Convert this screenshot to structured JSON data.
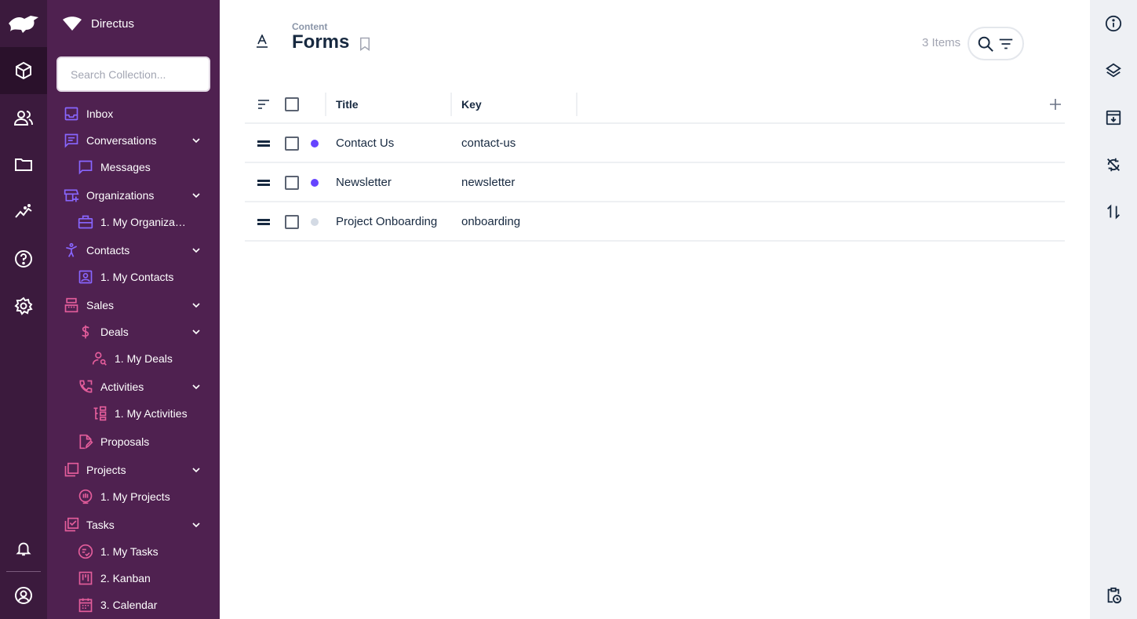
{
  "app": {
    "project_name": "Directus"
  },
  "module_bar": {
    "items": [
      "content-icon",
      "users-icon",
      "files-icon",
      "insights-icon",
      "help-icon",
      "settings-icon"
    ],
    "bottom": [
      "notifications-icon",
      "account-icon"
    ]
  },
  "nav": {
    "search_placeholder": "Search Collection...",
    "items": [
      {
        "label": "Inbox",
        "icon": "inbox-icon"
      },
      {
        "label": "Conversations",
        "icon": "chat-icon"
      },
      {
        "label": "Messages",
        "icon": "message-icon"
      },
      {
        "label": "Organizations",
        "icon": "domain-add-icon"
      },
      {
        "label": "1. My Organiza…",
        "icon": "briefcase-icon"
      },
      {
        "label": "Contacts",
        "icon": "person-icon"
      },
      {
        "label": "1. My Contacts",
        "icon": "contact-card-icon"
      },
      {
        "label": "Sales",
        "icon": "register-icon"
      },
      {
        "label": "Deals",
        "icon": "dollar-icon"
      },
      {
        "label": "1. My Deals",
        "icon": "person-search-icon"
      },
      {
        "label": "Activities",
        "icon": "phone-forward-icon"
      },
      {
        "label": "1. My Activities",
        "icon": "tree-icon"
      },
      {
        "label": "Proposals",
        "icon": "edit-document-icon"
      },
      {
        "label": "Projects",
        "icon": "library-icon"
      },
      {
        "label": "1. My Projects",
        "icon": "hand-icon"
      },
      {
        "label": "Tasks",
        "icon": "checkbox-icon"
      },
      {
        "label": "1. My Tasks",
        "icon": "task-list-icon"
      },
      {
        "label": "2. Kanban",
        "icon": "kanban-icon"
      },
      {
        "label": "3. Calendar",
        "icon": "calendar-icon"
      }
    ]
  },
  "header": {
    "breadcrumb": "Content",
    "title": "Forms",
    "items_count": "3 Items"
  },
  "table": {
    "columns": [
      "Title",
      "Key"
    ],
    "rows": [
      {
        "title": "Contact Us",
        "key": "contact-us",
        "status_color": "#6644ff"
      },
      {
        "title": "Newsletter",
        "key": "newsletter",
        "status_color": "#6644ff"
      },
      {
        "title": "Project Onboarding",
        "key": "onboarding",
        "status_color": "#d3dae4"
      }
    ]
  },
  "colors": {
    "module_bar": "#3b1a3d",
    "nav_bg": "#4f2150",
    "accent": "#6644ff",
    "pink_icon": "#e35d9b",
    "right_bar": "#eef0f4"
  },
  "right_bar": {
    "items": [
      "info-icon",
      "layers-icon",
      "archive-icon",
      "no-sync-icon",
      "import-export-icon"
    ],
    "bottom": "clipboard-clock-icon"
  }
}
